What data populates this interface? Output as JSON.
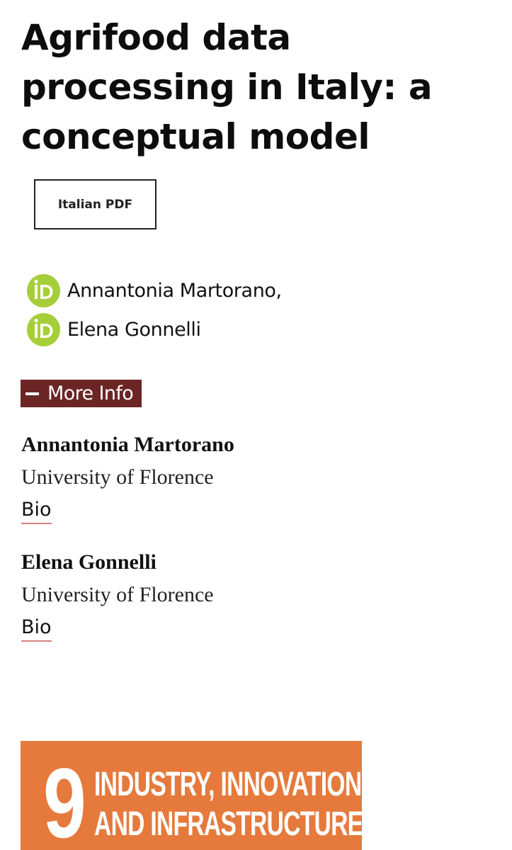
{
  "article": {
    "title": "Agrifood data processing in Italy: a conceptual model",
    "pdf_button_label": "Italian PDF"
  },
  "authors": [
    {
      "name": "Annantonia Martorano,"
    },
    {
      "name": "Elena Gonnelli"
    }
  ],
  "more_info": {
    "label": "More Info",
    "icon": "minus-icon"
  },
  "affiliations": [
    {
      "name": "Annantonia Martorano",
      "institution": "University of Florence",
      "bio_label": "Bio"
    },
    {
      "name": "Elena Gonnelli",
      "institution": "University of Florence",
      "bio_label": "Bio"
    }
  ],
  "sdg": {
    "number": "9",
    "line1": "INDUSTRY, INNOVATION",
    "line2": "AND INFRASTRUCTURE",
    "color": "#e57a3c"
  },
  "colors": {
    "orcid_green": "#a6ce39",
    "more_info_bg": "#6b2525",
    "bio_underline": "#d98080"
  }
}
